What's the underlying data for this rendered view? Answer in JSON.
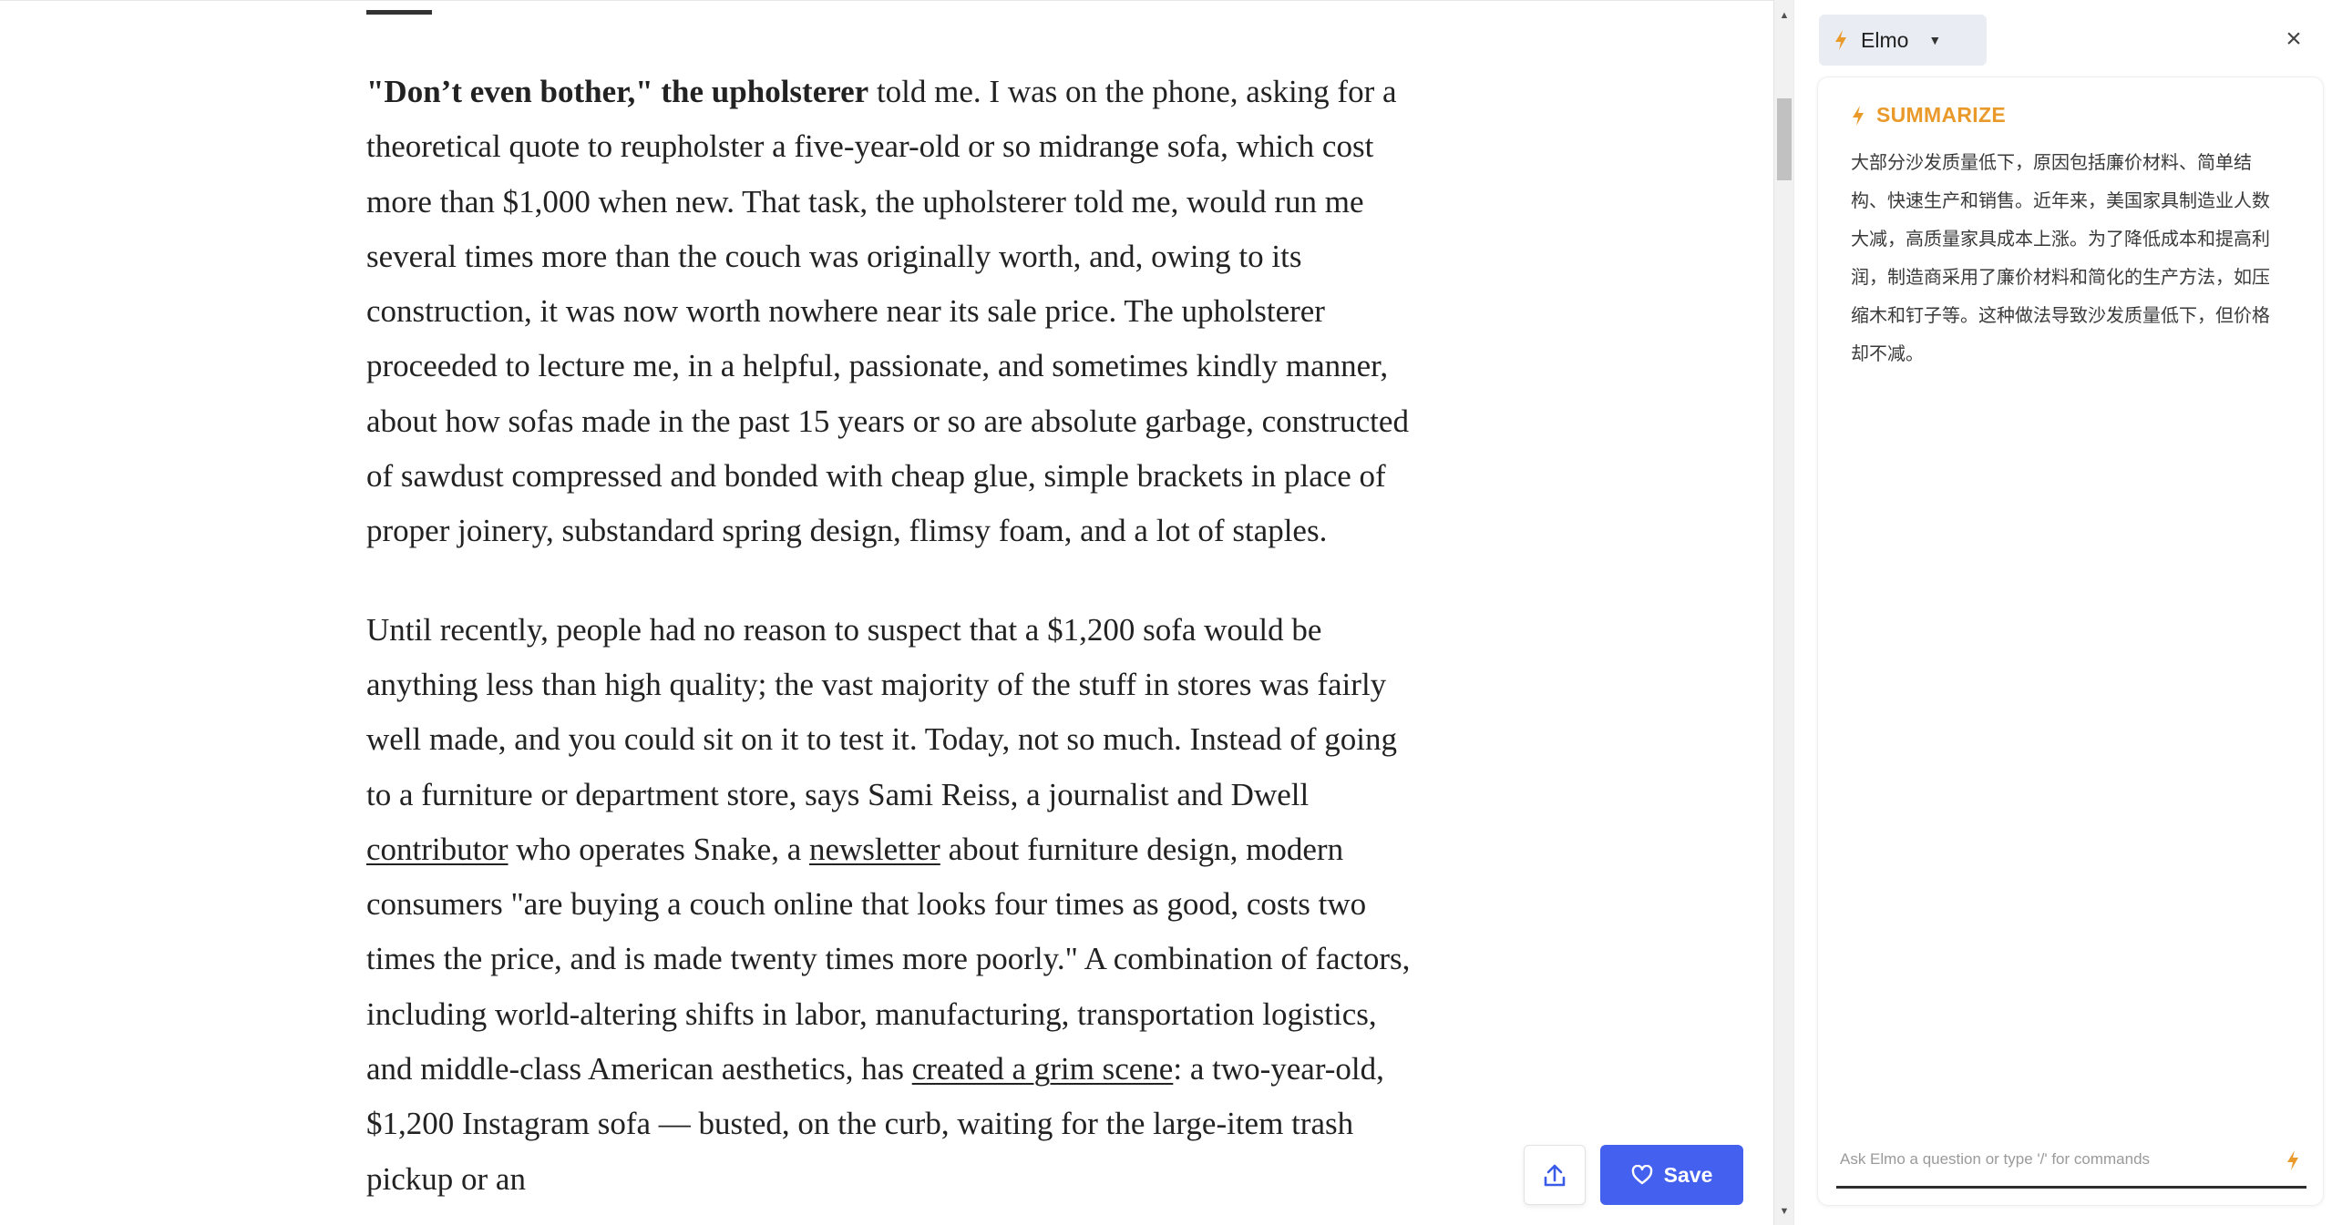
{
  "article": {
    "p1_lead": "\"Don’t even bother,\" the upholsterer",
    "p1_rest": " told me. I was on the phone, asking for a theoretical quote to reupholster a five-year-old or so midrange sofa, which cost more than $1,000 when new. That task, the upholsterer told me, would run me several times more than the couch was originally worth, and, owing to its construction, it was now worth nowhere near its sale price. The upholsterer proceeded to lecture me, in a helpful, passionate, and sometimes kindly manner, about how sofas made in the past 15 years or so are absolute garbage, constructed of sawdust compressed and bonded with cheap glue, simple brackets in place of proper joinery, substandard spring design, flimsy foam, and a lot of staples.",
    "p2_a": "Until recently, people had no reason to suspect that a $1,200 sofa would be anything less than high quality; the vast majority of the stuff in stores was fairly well made, and you could sit on it to test it. Today, not so much. Instead of going to a furniture or department store, says Sami Reiss, a journalist and Dwell ",
    "p2_link1": "contributor",
    "p2_b": " who operates Snake, a ",
    "p2_link2": "newsletter",
    "p2_c": " about furniture design, modern consumers \"are buying a couch online that looks four times as good, costs two times the price, and is made twenty times more poorly.\" A combination of factors, including world-altering shifts in labor, manufacturing, transportation logistics, and middle-class American aesthetics, has ",
    "p2_link3": "created a grim scene",
    "p2_d": ": a two-year-old, $1,200 Instagram sofa — busted, on the curb, waiting for the large-item trash pickup or an"
  },
  "actions": {
    "save_label": "Save",
    "share_icon": "upload-icon",
    "save_icon": "heart-icon",
    "accent_color": "#4460ef"
  },
  "panel": {
    "assistant_name": "Elmo",
    "summary_title": "SUMMARIZE",
    "summary_text": "大部分沙发质量低下，原因包括廉价材料、简单结构、快速生产和销售。近年来，美国家具制造业人数大减，高质量家具成本上涨。为了降低成本和提高利润，制造商采用了廉价材料和简化的生产方法，如压缩木和钉子等。这种做法导致沙发质量低下，但价格却不减。",
    "ask_placeholder": "Ask Elmo a question or type '/' for commands",
    "accent_color": "#e99a2b"
  }
}
